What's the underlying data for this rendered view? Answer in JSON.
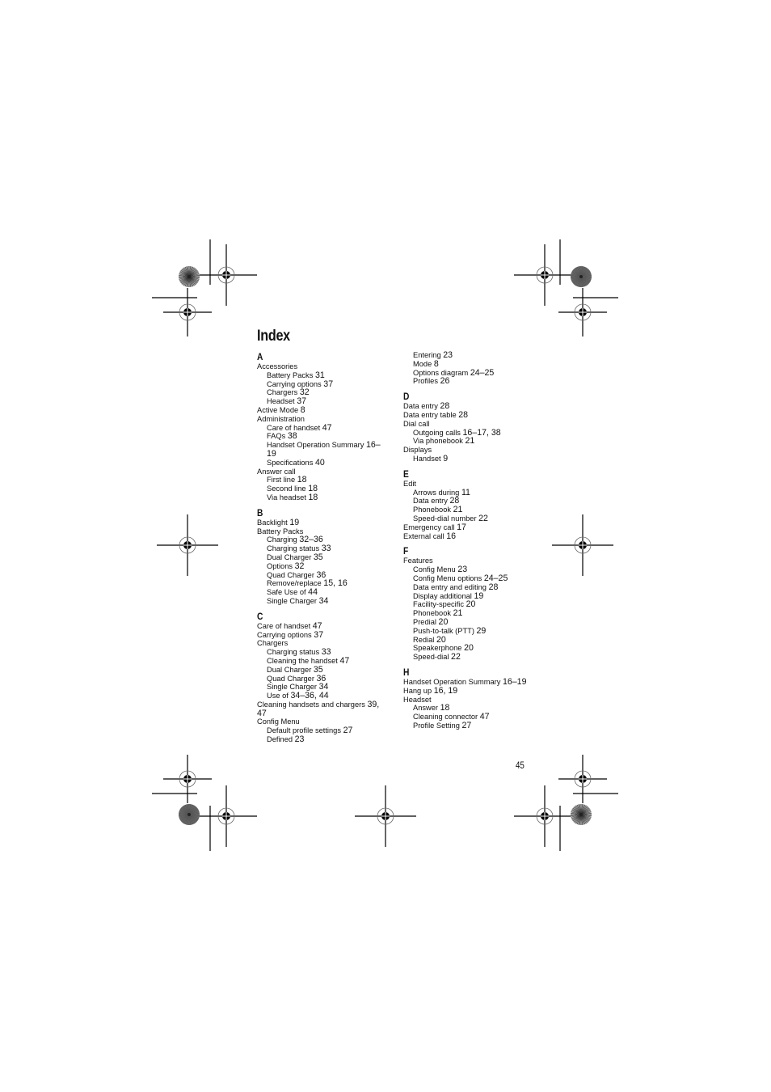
{
  "page": {
    "title": "Index",
    "page_number": "45"
  },
  "columns": [
    {
      "sections": [
        {
          "letter": "A",
          "entries": [
            {
              "text": "Accessories",
              "pages": "",
              "level": 0
            },
            {
              "text": "Battery Packs",
              "pages": "31",
              "level": 1
            },
            {
              "text": "Carrying options",
              "pages": "37",
              "level": 1
            },
            {
              "text": "Chargers",
              "pages": "32",
              "level": 1
            },
            {
              "text": "Headset",
              "pages": "37",
              "level": 1
            },
            {
              "text": "Active Mode",
              "pages": "8",
              "level": 0
            },
            {
              "text": "Administration",
              "pages": "",
              "level": 0
            },
            {
              "text": "Care of handset",
              "pages": "47",
              "level": 1
            },
            {
              "text": "FAQs",
              "pages": "38",
              "level": 1
            },
            {
              "text": "Handset Operation Summary",
              "pages": "16–19",
              "level": 1
            },
            {
              "text": "Specifications",
              "pages": "40",
              "level": 1
            },
            {
              "text": "Answer call",
              "pages": "",
              "level": 0
            },
            {
              "text": "First line",
              "pages": "18",
              "level": 1
            },
            {
              "text": "Second line",
              "pages": "18",
              "level": 1
            },
            {
              "text": "Via headset",
              "pages": "18",
              "level": 1
            }
          ]
        },
        {
          "letter": "B",
          "entries": [
            {
              "text": "Backlight",
              "pages": "19",
              "level": 0
            },
            {
              "text": "Battery Packs",
              "pages": "",
              "level": 0
            },
            {
              "text": "Charging",
              "pages": "32–36",
              "level": 1
            },
            {
              "text": "Charging status",
              "pages": "33",
              "level": 1
            },
            {
              "text": "Dual Charger",
              "pages": "35",
              "level": 1
            },
            {
              "text": "Options",
              "pages": "32",
              "level": 1
            },
            {
              "text": "Quad Charger",
              "pages": "36",
              "level": 1
            },
            {
              "text": "Remove/replace",
              "pages": "15, 16",
              "level": 1
            },
            {
              "text": "Safe Use of",
              "pages": "44",
              "level": 1
            },
            {
              "text": "Single Charger",
              "pages": "34",
              "level": 1
            }
          ]
        },
        {
          "letter": "C",
          "entries": [
            {
              "text": "Care of handset",
              "pages": "47",
              "level": 0
            },
            {
              "text": "Carrying options",
              "pages": "37",
              "level": 0
            },
            {
              "text": "Chargers",
              "pages": "",
              "level": 0
            },
            {
              "text": "Charging status",
              "pages": "33",
              "level": 1
            },
            {
              "text": "Cleaning the handset",
              "pages": "47",
              "level": 1
            },
            {
              "text": "Dual Charger",
              "pages": "35",
              "level": 1
            },
            {
              "text": "Quad Charger",
              "pages": "36",
              "level": 1
            },
            {
              "text": "Single Charger",
              "pages": "34",
              "level": 1
            },
            {
              "text": "Use of",
              "pages": "34–36, 44",
              "level": 1
            },
            {
              "text": "Cleaning handsets and chargers",
              "pages": "39, 47",
              "level": 0
            },
            {
              "text": "Config Menu",
              "pages": "",
              "level": 0
            },
            {
              "text": "Default profile settings",
              "pages": "27",
              "level": 1
            },
            {
              "text": "Defined",
              "pages": "23",
              "level": 1
            }
          ]
        }
      ]
    },
    {
      "sections": [
        {
          "letter": "",
          "entries": [
            {
              "text": "Entering",
              "pages": "23",
              "level": 1
            },
            {
              "text": "Mode",
              "pages": "8",
              "level": 1
            },
            {
              "text": "Options diagram",
              "pages": "24–25",
              "level": 1
            },
            {
              "text": "Profiles",
              "pages": "26",
              "level": 1
            }
          ]
        },
        {
          "letter": "D",
          "entries": [
            {
              "text": "Data entry",
              "pages": "28",
              "level": 0
            },
            {
              "text": "Data entry table",
              "pages": "28",
              "level": 0
            },
            {
              "text": "Dial call",
              "pages": "",
              "level": 0
            },
            {
              "text": "Outgoing calls",
              "pages": "16–17, 38",
              "level": 1
            },
            {
              "text": "Via phonebook",
              "pages": "21",
              "level": 1
            },
            {
              "text": "Displays",
              "pages": "",
              "level": 0
            },
            {
              "text": "Handset",
              "pages": "9",
              "level": 1
            }
          ]
        },
        {
          "letter": "E",
          "entries": [
            {
              "text": "Edit",
              "pages": "",
              "level": 0
            },
            {
              "text": "Arrows during",
              "pages": "11",
              "level": 1
            },
            {
              "text": "Data entry",
              "pages": "28",
              "level": 1
            },
            {
              "text": "Phonebook",
              "pages": "21",
              "level": 1
            },
            {
              "text": "Speed-dial number",
              "pages": "22",
              "level": 1
            },
            {
              "text": "Emergency call",
              "pages": "17",
              "level": 0
            },
            {
              "text": "External call",
              "pages": "16",
              "level": 0
            }
          ]
        },
        {
          "letter": "F",
          "entries": [
            {
              "text": "Features",
              "pages": "",
              "level": 0
            },
            {
              "text": "Config Menu",
              "pages": "23",
              "level": 1
            },
            {
              "text": "Config Menu options",
              "pages": "24–25",
              "level": 1
            },
            {
              "text": "Data entry and editing",
              "pages": "28",
              "level": 1
            },
            {
              "text": "Display additional",
              "pages": "19",
              "level": 1
            },
            {
              "text": "Facility-specific",
              "pages": "20",
              "level": 1
            },
            {
              "text": "Phonebook",
              "pages": "21",
              "level": 1
            },
            {
              "text": "Predial",
              "pages": "20",
              "level": 1
            },
            {
              "text": "Push-to-talk (PTT)",
              "pages": "29",
              "level": 1
            },
            {
              "text": "Redial",
              "pages": "20",
              "level": 1
            },
            {
              "text": "Speakerphone",
              "pages": "20",
              "level": 1
            },
            {
              "text": "Speed-dial",
              "pages": "22",
              "level": 1
            }
          ]
        },
        {
          "letter": "H",
          "entries": [
            {
              "text": "Handset Operation Summary",
              "pages": "16–19",
              "level": 0
            },
            {
              "text": "Hang up",
              "pages": "16, 19",
              "level": 0
            },
            {
              "text": "Headset",
              "pages": "",
              "level": 0
            },
            {
              "text": "Answer",
              "pages": "18",
              "level": 1
            },
            {
              "text": "Cleaning connector",
              "pages": "47",
              "level": 1
            },
            {
              "text": "Profile Setting",
              "pages": "27",
              "level": 1
            }
          ]
        }
      ]
    }
  ],
  "print_marks": {
    "registration_mark_icon": "crosshair-target",
    "color_bar_icon": "starburst-circle"
  }
}
